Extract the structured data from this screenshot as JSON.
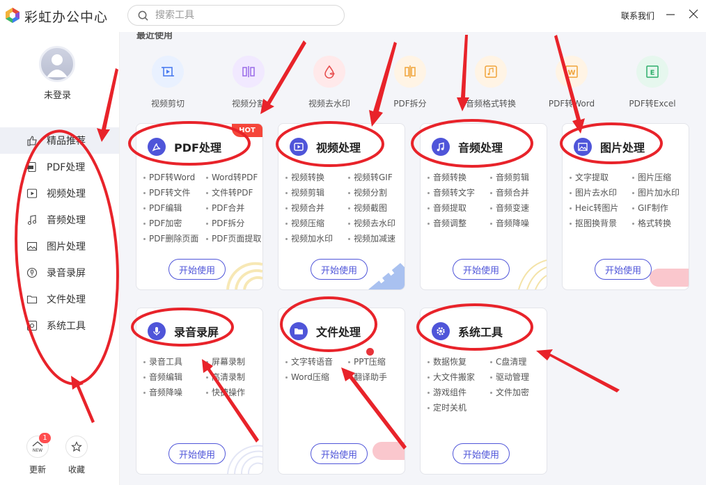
{
  "app": {
    "title": "彩虹办公中心",
    "contact": "联系我们"
  },
  "search": {
    "placeholder": "搜索工具"
  },
  "user": {
    "login_label": "未登录"
  },
  "sidebar": {
    "items": [
      {
        "label": "精品推荐",
        "icon": "thumbs-up-icon",
        "active": true
      },
      {
        "label": "PDF处理",
        "icon": "pdf-icon"
      },
      {
        "label": "视频处理",
        "icon": "video-icon"
      },
      {
        "label": "音频处理",
        "icon": "music-note-icon"
      },
      {
        "label": "图片处理",
        "icon": "image-icon"
      },
      {
        "label": "录音录屏",
        "icon": "mic-icon"
      },
      {
        "label": "文件处理",
        "icon": "folder-icon"
      },
      {
        "label": "系统工具",
        "icon": "system-icon"
      }
    ],
    "bottom": {
      "update_label": "更新",
      "update_badge": "1",
      "update_icon_text": "NEW",
      "favorite_label": "收藏"
    }
  },
  "recent": {
    "title": "最近使用",
    "items": [
      {
        "label": "视频剪切",
        "color": "#e9f1ff",
        "icon": "video-crop-icon"
      },
      {
        "label": "视频分割",
        "color": "#f1e9ff",
        "icon": "video-split-icon"
      },
      {
        "label": "视频去水印",
        "color": "#ffe9ea",
        "icon": "watermark-remove-icon"
      },
      {
        "label": "PDF拆分",
        "color": "#fff4e5",
        "icon": "pdf-split-icon"
      },
      {
        "label": "音频格式转换",
        "color": "#fff4e5",
        "icon": "audio-convert-icon"
      },
      {
        "label": "PDF转Word",
        "color": "#fff4e5",
        "icon": "pdf-to-word-icon"
      },
      {
        "label": "PDF转Excel",
        "color": "#e6f7ee",
        "icon": "pdf-to-excel-icon"
      }
    ]
  },
  "cards": [
    {
      "title": "PDF处理",
      "hot": "HOT",
      "button": "开始使用",
      "items": [
        "PDF转Word",
        "Word转PDF",
        "PDF转文件",
        "文件转PDF",
        "PDF编辑",
        "PDF合并",
        "PDF加密",
        "PDF拆分",
        "PDF删除页面",
        "PDF页面提取"
      ]
    },
    {
      "title": "视频处理",
      "button": "开始使用",
      "items": [
        "视频转换",
        "视频转GIF",
        "视频剪辑",
        "视频分割",
        "视频合并",
        "视频截图",
        "视频压缩",
        "视频去水印",
        "视频加水印",
        "视频加减速"
      ]
    },
    {
      "title": "音频处理",
      "button": "开始使用",
      "items": [
        "音频转换",
        "音频剪辑",
        "音频转文字",
        "音频合并",
        "音频提取",
        "音频变速",
        "音频调整",
        "音频降噪"
      ]
    },
    {
      "title": "图片处理",
      "button": "开始使用",
      "items": [
        "文字提取",
        "图片压缩",
        "图片去水印",
        "图片加水印",
        "Heic转图片",
        "GIF制作",
        "抠图换背景",
        "格式转换"
      ]
    },
    {
      "title": "录音录屏",
      "button": "开始使用",
      "items": [
        "录音工具",
        "屏幕录制",
        "音频编辑",
        "高清录制",
        "音频降噪",
        "快捷操作"
      ]
    },
    {
      "title": "文件处理",
      "button": "开始使用",
      "items": [
        "文字转语音",
        "PPT压缩",
        "Word压缩",
        "翻译助手"
      ]
    },
    {
      "title": "系统工具",
      "button": "开始使用",
      "items": [
        "数据恢复",
        "C盘清理",
        "大文件搬家",
        "驱动管理",
        "游戏组件",
        "文件加密",
        "定时关机"
      ]
    }
  ],
  "colors": {
    "accent": "#4f55d9",
    "annotation": "#e8232a",
    "hot": "#f5463a"
  }
}
